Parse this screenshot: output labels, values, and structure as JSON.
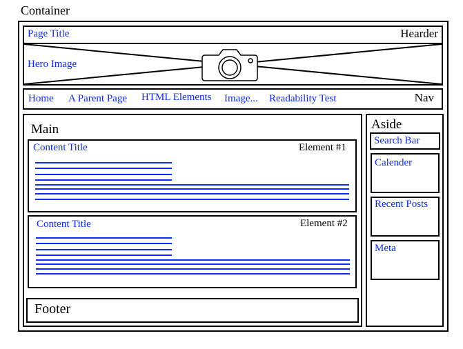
{
  "diagram_title": "Container",
  "header": {
    "page_title": "Page Title",
    "label": "Hearder",
    "hero_label": "Hero Image",
    "hero_icon": "camera-icon"
  },
  "nav": {
    "label": "Nav",
    "links": [
      "Home",
      "A Parent Page",
      "HTML Elements",
      "Image...",
      "Readability Test"
    ]
  },
  "main": {
    "label": "Main",
    "elements": [
      {
        "title": "Content Title",
        "label": "Element #1"
      },
      {
        "title": "Content Title",
        "label": "Element #2"
      }
    ],
    "footer": "Footer"
  },
  "aside": {
    "label": "Aside",
    "widgets": [
      "Search Bar",
      "Calender",
      "Recent Posts",
      "Meta"
    ]
  },
  "colors": {
    "accent": "#0a2aff",
    "border": "#000000"
  }
}
